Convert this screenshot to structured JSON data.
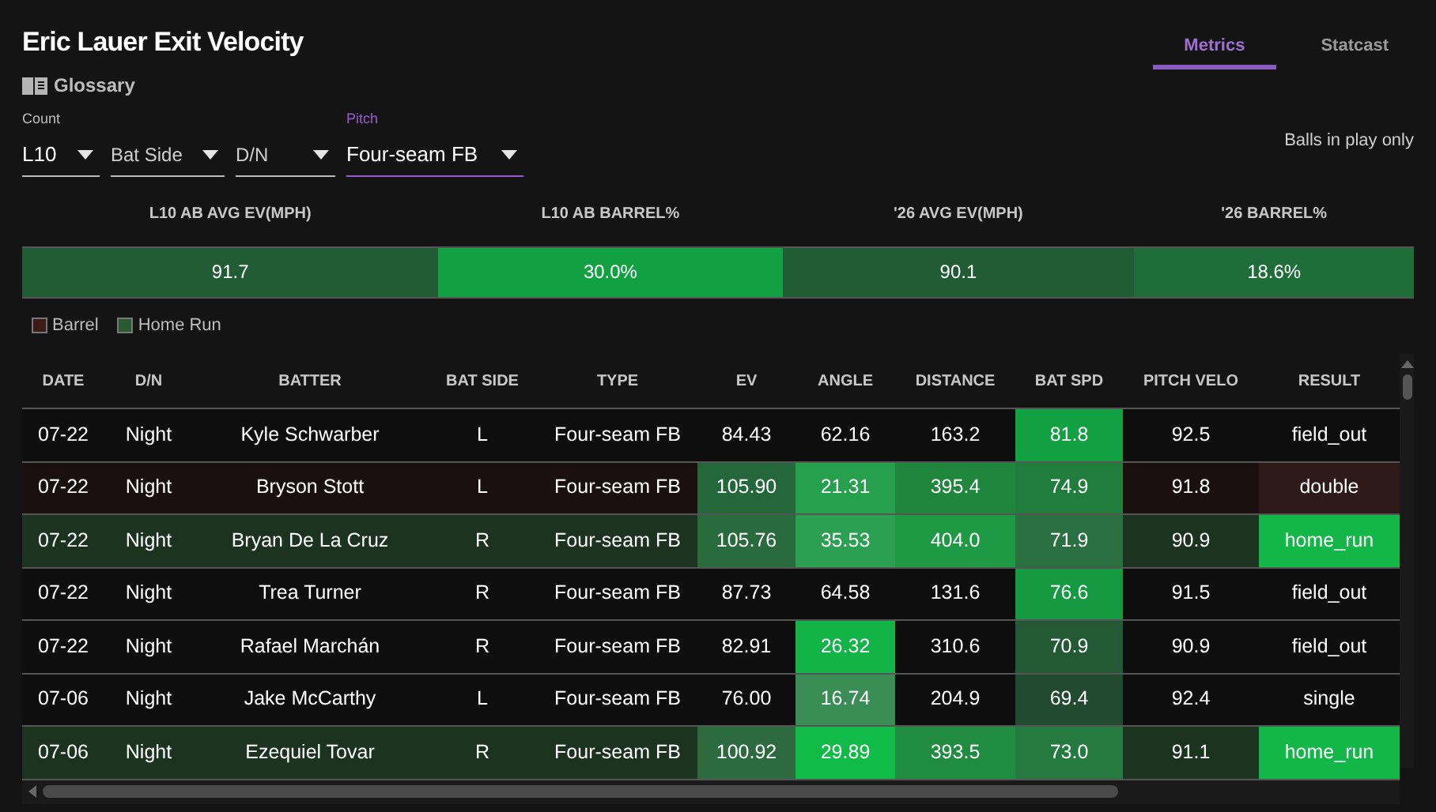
{
  "title": "Eric Lauer Exit Velocity",
  "glossary": "Glossary",
  "tabs": [
    {
      "label": "Metrics",
      "selected": true
    },
    {
      "label": "Statcast",
      "selected": false
    }
  ],
  "filters": [
    {
      "label": "Count",
      "value": "L10",
      "active": false
    },
    {
      "value": "Bat Side",
      "active": false
    },
    {
      "value": "D/N",
      "active": false
    },
    {
      "label": "Pitch",
      "value": "Four-seam FB",
      "active": true
    }
  ],
  "note": "Balls in play only",
  "stats": [
    {
      "label": "L10 AB AVG EV(MPH)",
      "value": "91.7",
      "color": "#225c35"
    },
    {
      "label": "L10 AB BARREL%",
      "value": "30.0%",
      "color": "#12a142"
    },
    {
      "label": "'26 AVG EV(MPH)",
      "value": "90.1",
      "color": "#225c35"
    },
    {
      "label": "'26 BARREL%",
      "value": "18.6%",
      "color": "#1f6e3a"
    }
  ],
  "legend": [
    {
      "label": "Barrel",
      "color": "#3a1a1a"
    },
    {
      "label": "Home Run",
      "color": "#2a5a30"
    }
  ],
  "table": {
    "columns": [
      "DATE",
      "D/N",
      "BATTER",
      "BAT SIDE",
      "TYPE",
      "EV",
      "ANGLE",
      "DISTANCE",
      "BAT SPD",
      "PITCH VELO",
      "RESULT"
    ],
    "rows": [
      {
        "barrel": false,
        "home_run": false,
        "cells": [
          {
            "text": "07-22"
          },
          {
            "text": "Night"
          },
          {
            "text": "Kyle Schwarber"
          },
          {
            "text": "L"
          },
          {
            "text": "Four-seam FB"
          },
          {
            "text": "84.43"
          },
          {
            "text": "62.16"
          },
          {
            "text": "163.2"
          },
          {
            "text": "81.8",
            "color": "#12a142"
          },
          {
            "text": "92.5"
          },
          {
            "text": "field_out"
          }
        ]
      },
      {
        "barrel": true,
        "home_run": false,
        "cells": [
          {
            "text": "07-22"
          },
          {
            "text": "Night"
          },
          {
            "text": "Bryson Stott"
          },
          {
            "text": "L"
          },
          {
            "text": "Four-seam FB"
          },
          {
            "text": "105.90",
            "color": "#23673a"
          },
          {
            "text": "21.31",
            "color": "#26a04c"
          },
          {
            "text": "395.4",
            "color": "#1f863c"
          },
          {
            "text": "74.9",
            "color": "#207d3c"
          },
          {
            "text": "91.8"
          },
          {
            "text": "double",
            "color": "#2f1a1a"
          }
        ]
      },
      {
        "barrel": false,
        "home_run": true,
        "cells": [
          {
            "text": "07-22"
          },
          {
            "text": "Night"
          },
          {
            "text": "Bryan De La Cruz"
          },
          {
            "text": "R"
          },
          {
            "text": "Four-seam FB"
          },
          {
            "text": "105.76",
            "color": "#2a6b3d"
          },
          {
            "text": "35.53",
            "color": "#2aa050"
          },
          {
            "text": "404.0",
            "color": "#1e9a44"
          },
          {
            "text": "71.9",
            "color": "#2a7040"
          },
          {
            "text": "90.9"
          },
          {
            "text": "home_run",
            "color": "#12b748"
          }
        ]
      },
      {
        "barrel": false,
        "home_run": false,
        "cells": [
          {
            "text": "07-22"
          },
          {
            "text": "Night"
          },
          {
            "text": "Trea Turner"
          },
          {
            "text": "R"
          },
          {
            "text": "Four-seam FB"
          },
          {
            "text": "87.73"
          },
          {
            "text": "64.58"
          },
          {
            "text": "131.6"
          },
          {
            "text": "76.6",
            "color": "#159a42"
          },
          {
            "text": "91.5"
          },
          {
            "text": "field_out"
          }
        ]
      },
      {
        "barrel": false,
        "home_run": false,
        "cells": [
          {
            "text": "07-22"
          },
          {
            "text": "Night"
          },
          {
            "text": "Rafael Marchán"
          },
          {
            "text": "R"
          },
          {
            "text": "Four-seam FB"
          },
          {
            "text": "82.91"
          },
          {
            "text": "26.32",
            "color": "#12b448"
          },
          {
            "text": "310.6"
          },
          {
            "text": "70.9",
            "color": "#235a35"
          },
          {
            "text": "90.9"
          },
          {
            "text": "field_out"
          }
        ]
      },
      {
        "barrel": false,
        "home_run": false,
        "cells": [
          {
            "text": "07-06"
          },
          {
            "text": "Night"
          },
          {
            "text": "Jake McCarthy"
          },
          {
            "text": "L"
          },
          {
            "text": "Four-seam FB"
          },
          {
            "text": "76.00"
          },
          {
            "text": "16.74",
            "color": "#3a8e55"
          },
          {
            "text": "204.9"
          },
          {
            "text": "69.4",
            "color": "#214a30"
          },
          {
            "text": "92.4"
          },
          {
            "text": "single"
          }
        ]
      },
      {
        "barrel": false,
        "home_run": true,
        "cells": [
          {
            "text": "07-06"
          },
          {
            "text": "Night"
          },
          {
            "text": "Ezequiel Tovar"
          },
          {
            "text": "R"
          },
          {
            "text": "Four-seam FB"
          },
          {
            "text": "100.92",
            "color": "#2d6a40"
          },
          {
            "text": "29.89",
            "color": "#10bb48"
          },
          {
            "text": "393.5",
            "color": "#1f8c40"
          },
          {
            "text": "73.0",
            "color": "#257a40"
          },
          {
            "text": "91.1"
          },
          {
            "text": "home_run",
            "color": "#12b748"
          }
        ]
      }
    ]
  }
}
